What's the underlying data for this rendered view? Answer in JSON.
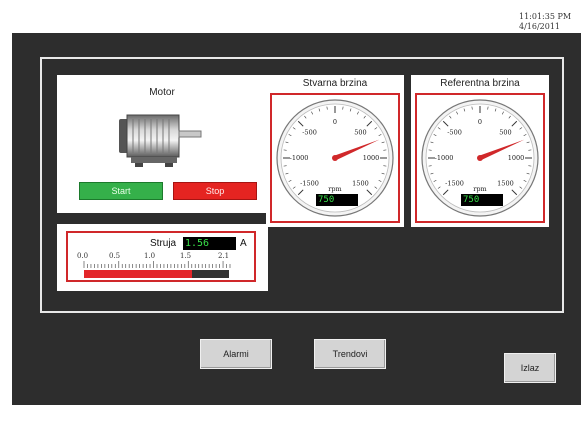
{
  "clock": {
    "time": "11:01:35 PM",
    "date": "4/16/2011"
  },
  "motor": {
    "title": "Motor",
    "start_label": "Start",
    "stop_label": "Stop"
  },
  "current": {
    "label": "Struja",
    "value": "1.56",
    "unit": "A",
    "scale": [
      "0.0",
      "0.5",
      "1.0",
      "1.5",
      "2.1"
    ],
    "min": 0.0,
    "max": 2.1,
    "level": 1.56
  },
  "gauges": [
    {
      "title": "Stvarna brzina",
      "unit": "rpm",
      "value": "750",
      "reading": 750,
      "ticks": [
        "-1500",
        "-1000",
        "-500",
        "0",
        "500",
        "1000",
        "1500"
      ]
    },
    {
      "title": "Referentna brzina",
      "unit": "rpm",
      "value": "750",
      "reading": 750,
      "ticks": [
        "-1500",
        "-1000",
        "-500",
        "0",
        "500",
        "1000",
        "1500"
      ]
    }
  ],
  "buttons": {
    "alarms": "Alarmi",
    "trends": "Trendovi",
    "exit": "Izlaz"
  },
  "colors": {
    "start": "#35b04a",
    "stop": "#e52421",
    "needle": "#d0282a",
    "readout_text": "#39e04a",
    "background": "#2d2d2d"
  }
}
